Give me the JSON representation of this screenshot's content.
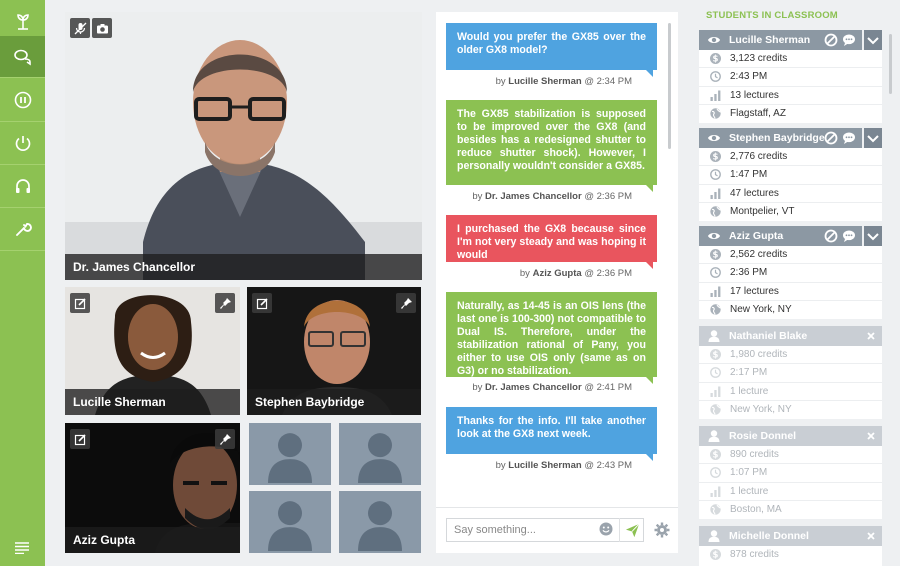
{
  "nav": {
    "items": [
      {
        "name": "logo",
        "active": false
      },
      {
        "name": "chat",
        "active": true
      },
      {
        "name": "pause",
        "active": false
      },
      {
        "name": "power",
        "active": false
      },
      {
        "name": "headphones",
        "active": false
      },
      {
        "name": "wrench",
        "active": false
      }
    ]
  },
  "video": {
    "main": {
      "name": "Dr. James Chancellor"
    },
    "tiles": [
      {
        "name": "Lucille Sherman"
      },
      {
        "name": "Stephen Baybridge"
      },
      {
        "name": "Aziz Gupta"
      }
    ]
  },
  "chat": {
    "messages": [
      {
        "text": "Would you prefer the GX85 over the older GX8 model?",
        "author": "Lucille Sherman",
        "time": "2:34 PM",
        "color": "#4fa3e0"
      },
      {
        "text": "The GX85 stabilization is supposed to be improved over the GX8 (and besides has a redesigned shutter to reduce shutter shock). However, I personally wouldn't consider a GX85.",
        "author": "Dr. James Chancellor",
        "time": "2:36 PM",
        "color": "#8cc152"
      },
      {
        "text": "I purchased the GX8 because since I'm not very steady and was hoping it would",
        "author": "Aziz Gupta",
        "time": "2:36 PM",
        "color": "#e9555e"
      },
      {
        "text": "Naturally, as 14-45 is an OIS lens (the last one is 100-300) not compatible to Dual IS. Therefore, under the stabilization rational of Pany, you either to use OIS only (same as on G3) or no stabilization.",
        "author": "Dr. James Chancellor",
        "time": "2:41 PM",
        "color": "#8cc152"
      },
      {
        "text": "Thanks for the info. I'll take another look at the GX8 next week.",
        "author": "Lucille Sherman",
        "time": "2:43 PM",
        "color": "#4fa3e0"
      }
    ],
    "by": "by",
    "at": "@",
    "input_placeholder": "Say something..."
  },
  "students": {
    "title": "STUDENTS IN CLASSROOM",
    "list": [
      {
        "name": "Lucille Sherman",
        "credits": "3,123 credits",
        "time": "2:43 PM",
        "lectures": "13 lectures",
        "location": "Flagstaff, AZ",
        "active": true
      },
      {
        "name": "Stephen Baybridge",
        "credits": "2,776 credits",
        "time": "1:47 PM",
        "lectures": "47 lectures",
        "location": "Montpelier, VT",
        "active": true
      },
      {
        "name": "Aziz Gupta",
        "credits": "2,562 credits",
        "time": "2:36 PM",
        "lectures": "17 lectures",
        "location": "New York, NY",
        "active": true
      },
      {
        "name": "Nathaniel Blake",
        "credits": "1,980 credits",
        "time": "2:17 PM",
        "lectures": "1 lecture",
        "location": "New York, NY",
        "active": false
      },
      {
        "name": "Rosie Donnel",
        "credits": "890 credits",
        "time": "1:07 PM",
        "lectures": "1 lecture",
        "location": "Boston, MA",
        "active": false
      },
      {
        "name": "Michelle Donnel",
        "credits": "878 credits",
        "time": "",
        "lectures": "",
        "location": "",
        "active": false
      }
    ]
  },
  "colors": {
    "accent": "#8cc152",
    "blue": "#4fa3e0",
    "red": "#e9555e",
    "header_gray": "#8c98a3"
  }
}
